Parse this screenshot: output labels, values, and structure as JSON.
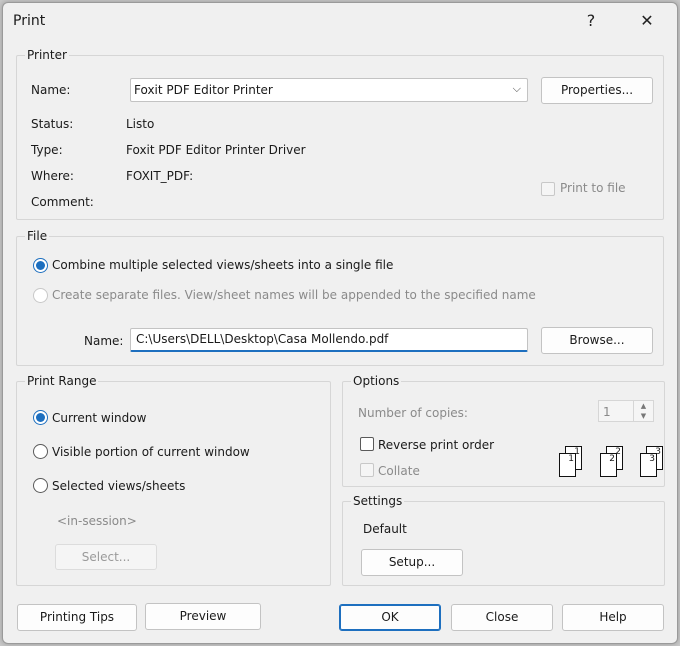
{
  "window": {
    "title": "Print",
    "help_glyph": "?",
    "close_glyph": "✕"
  },
  "printer": {
    "legend": "Printer",
    "name_label": "Name:",
    "name_value": "Foxit PDF Editor Printer",
    "properties_label": "Properties...",
    "status_label": "Status:",
    "status_value": "Listo",
    "type_label": "Type:",
    "type_value": "Foxit PDF Editor Printer Driver",
    "where_label": "Where:",
    "where_value": "FOXIT_PDF:",
    "comment_label": "Comment:",
    "print_to_file_label": "Print to file"
  },
  "file": {
    "legend": "File",
    "combine_label": "Combine multiple selected views/sheets into a single file",
    "separate_label": "Create separate files. View/sheet names will be appended to the specified name",
    "name_label": "Name:",
    "name_value": "C:\\Users\\DELL\\Desktop\\Casa Mollendo.pdf",
    "browse_label": "Browse..."
  },
  "print_range": {
    "legend": "Print Range",
    "current_label": "Current window",
    "visible_label": "Visible portion of current window",
    "selected_label": "Selected views/sheets",
    "session_text": "<in-session>",
    "select_label": "Select..."
  },
  "options": {
    "legend": "Options",
    "copies_label": "Number of copies:",
    "copies_value": "1",
    "reverse_label": "Reverse print order",
    "collate_label": "Collate",
    "collate_pages": [
      "1",
      "2",
      "3"
    ]
  },
  "settings": {
    "legend": "Settings",
    "value": "Default",
    "setup_label": "Setup..."
  },
  "footer": {
    "tips_label": "Printing Tips",
    "preview_label": "Preview",
    "ok_label": "OK",
    "close_label": "Close",
    "help_label": "Help"
  },
  "colors": {
    "accent": "#1d6fbf",
    "window_bg": "#f0f0f0"
  }
}
